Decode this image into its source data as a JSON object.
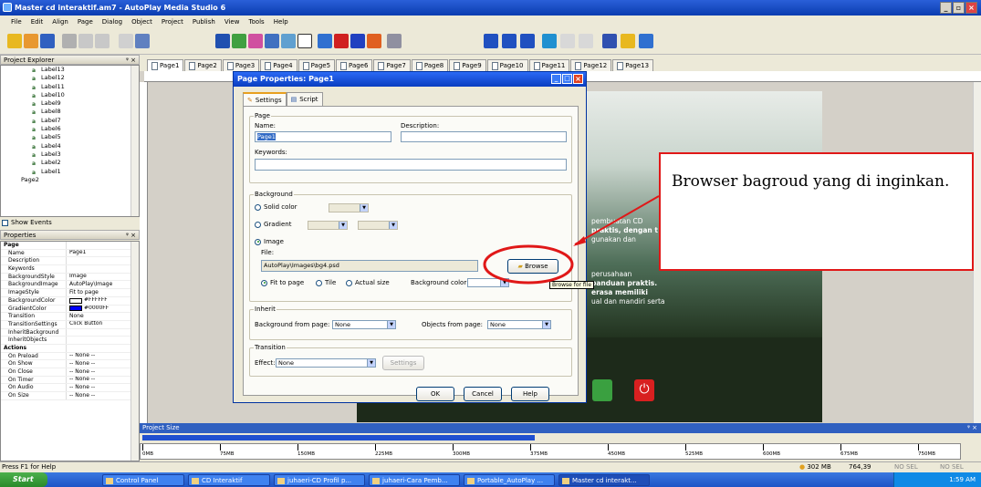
{
  "window": {
    "title": "Master cd interaktif.am7 - AutoPlay Media Studio 6"
  },
  "menu": [
    "File",
    "Edit",
    "Align",
    "Page",
    "Dialog",
    "Object",
    "Project",
    "Publish",
    "View",
    "Tools",
    "Help"
  ],
  "explorer": {
    "title": "Project Explorer",
    "items": [
      "Label13",
      "Label12",
      "Label11",
      "Label10",
      "Label9",
      "Label8",
      "Label7",
      "Label6",
      "Label5",
      "Label4",
      "Label3",
      "Label2",
      "Label1",
      "Page2"
    ],
    "show_events": "Show Events"
  },
  "properties": {
    "title": "Properties",
    "rows": [
      {
        "n": "Page",
        "v": "",
        "sec": true
      },
      {
        "n": "Name",
        "v": "Page1"
      },
      {
        "n": "Description",
        "v": ""
      },
      {
        "n": "Keywords",
        "v": ""
      },
      {
        "n": "BackgroundStyle",
        "v": "Image"
      },
      {
        "n": "BackgroundImage",
        "v": "AutoPlay\\Image"
      },
      {
        "n": "ImageStyle",
        "v": "Fit to page"
      },
      {
        "n": "BackgroundColor",
        "v": "#FFFFFF"
      },
      {
        "n": "GradientColor",
        "v": "#0000FF"
      },
      {
        "n": "Transition",
        "v": "None"
      },
      {
        "n": "TransitionSettings",
        "v": "Click Button"
      },
      {
        "n": "InheritBackground",
        "v": ""
      },
      {
        "n": "InheritObjects",
        "v": ""
      },
      {
        "n": "Actions",
        "v": "",
        "sec": true
      },
      {
        "n": "On Preload",
        "v": "-- None --"
      },
      {
        "n": "On Show",
        "v": "-- None --"
      },
      {
        "n": "On Close",
        "v": "-- None --"
      },
      {
        "n": "On Timer",
        "v": "-- None --"
      },
      {
        "n": "On Audio",
        "v": "-- None --"
      },
      {
        "n": "On Size",
        "v": "-- None --"
      }
    ]
  },
  "tabs": [
    "Page1",
    "Page2",
    "Page3",
    "Page4",
    "Page5",
    "Page6",
    "Page7",
    "Page8",
    "Page9",
    "Page10",
    "Page11",
    "Page12",
    "Page13"
  ],
  "dialog": {
    "title": "Page Properties: Page1",
    "tab_settings": "Settings",
    "tab_script": "Script",
    "page_group": "Page",
    "name_label": "Name:",
    "name_value": "Page1",
    "desc_label": "Description:",
    "keywords_label": "Keywords:",
    "bg_group": "Background",
    "solid": "Solid color",
    "gradient": "Gradient",
    "image": "Image",
    "file_label": "File:",
    "file_value": "AutoPlay\\Images\\bg4.psd",
    "browse": "Browse",
    "browse_tip": "Browse for file",
    "fit": "Fit to page",
    "tile": "Tile",
    "actual": "Actual size",
    "bgcolor_label": "Background color:",
    "inherit_group": "Inherit",
    "bg_from": "Background from page:",
    "bg_from_val": "None",
    "obj_from": "Objects from page:",
    "obj_from_val": "None",
    "trans_group": "Transition",
    "effect_label": "Effect:",
    "effect_val": "None",
    "settings_btn": "Settings",
    "ok": "OK",
    "cancel": "Cancel",
    "help": "Help"
  },
  "stage_text": [
    "pembuatan CD",
    "praktis, dengan t",
    "gunakan dan",
    "perusahaan",
    "panduan praktis.",
    "erasa memiliki",
    "ual dan mandiri serta"
  ],
  "projsize": {
    "title": "Project Size",
    "ticks": [
      "0MB",
      "75MB",
      "150MB",
      "225MB",
      "300MB",
      "375MB",
      "450MB",
      "525MB",
      "600MB",
      "675MB",
      "750MB"
    ]
  },
  "status": {
    "left": "Press F1 for Help",
    "mb": "302 MB",
    "coords": "764,39",
    "nosel1": "NO SEL",
    "nosel2": "NO SEL"
  },
  "taskbar": {
    "start": "Start",
    "tasks": [
      "Control Panel",
      "CD Interaktif",
      "juhaeri-CD Profil p...",
      "juhaeri-Cara Pemb...",
      "Portable_AutoPlay ...",
      "Master cd interakt..."
    ],
    "time": "1:59 AM"
  },
  "callout": {
    "text": "Browser bagroud yang di inginkan."
  }
}
